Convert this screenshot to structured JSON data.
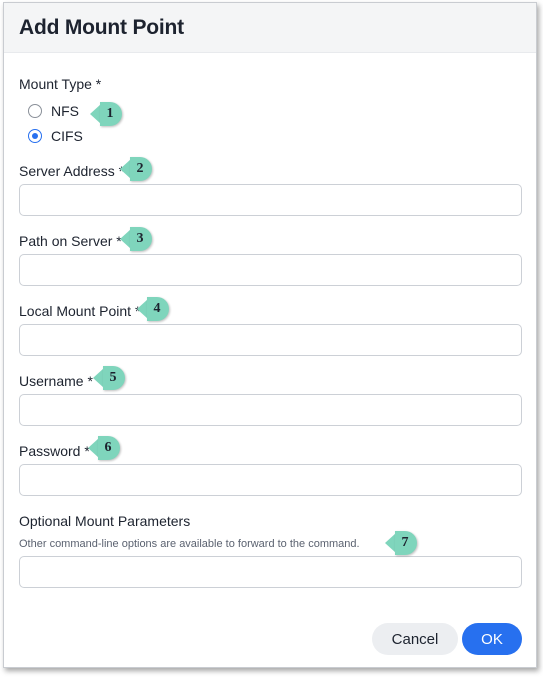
{
  "dialog": {
    "title": "Add Mount Point",
    "mount_type": {
      "label": "Mount Type *",
      "options": [
        {
          "label": "NFS",
          "checked": false
        },
        {
          "label": "CIFS",
          "checked": true
        }
      ]
    },
    "server_address": {
      "label": "Server Address *",
      "value": ""
    },
    "path_on_server": {
      "label": "Path on Server *",
      "value": ""
    },
    "local_mount_point": {
      "label": "Local Mount Point *",
      "value": ""
    },
    "username": {
      "label": "Username *",
      "value": ""
    },
    "password": {
      "label": "Password *",
      "value": ""
    },
    "optional_params": {
      "label": "Optional Mount Parameters",
      "hint": "Other command-line options are available to forward to the command.",
      "value": ""
    },
    "buttons": {
      "cancel": "Cancel",
      "ok": "OK"
    }
  },
  "callouts": [
    "1",
    "2",
    "3",
    "4",
    "5",
    "6",
    "7"
  ],
  "colors": {
    "accent": "#2770ef",
    "callout": "#7fd5bc"
  }
}
